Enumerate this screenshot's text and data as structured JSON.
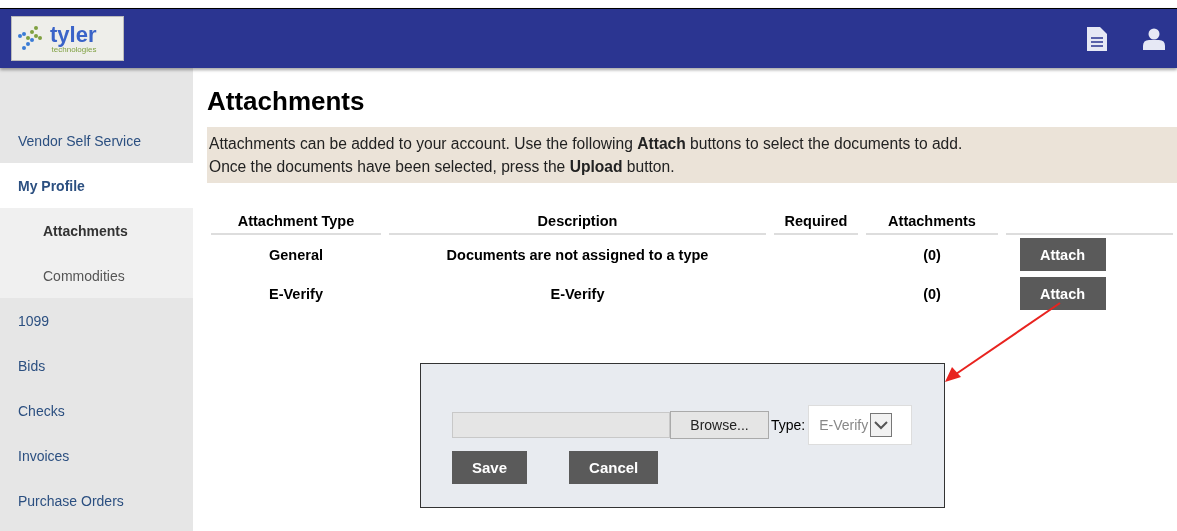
{
  "header": {
    "logo_word": "tyler",
    "logo_sub": "technologies"
  },
  "sidebar": {
    "items": [
      {
        "label": "Vendor Self Service",
        "kind": "section"
      },
      {
        "label": "My Profile",
        "kind": "item",
        "selected": true,
        "children": [
          {
            "label": "Attachments",
            "selected": true
          },
          {
            "label": "Commodities",
            "selected": false
          }
        ]
      },
      {
        "label": "1099",
        "kind": "item",
        "selected": false
      },
      {
        "label": "Bids",
        "kind": "item",
        "selected": false
      },
      {
        "label": "Checks",
        "kind": "item",
        "selected": false
      },
      {
        "label": "Invoices",
        "kind": "item",
        "selected": false
      },
      {
        "label": "Purchase Orders",
        "kind": "item",
        "selected": false
      }
    ]
  },
  "page": {
    "title": "Attachments",
    "instructions": [
      "Attachments can be added to your account. Use the following **Attach** buttons to select the documents to add.",
      "Once the documents have been selected, press the **Upload** button."
    ]
  },
  "table": {
    "columns": [
      "Attachment Type",
      "Description",
      "Required",
      "Attachments"
    ],
    "rows": [
      {
        "type": "General",
        "description": "Documents are not assigned to a type",
        "attachments": "(0)",
        "action": "Attach"
      },
      {
        "type": "E-Verify",
        "description": "E-Verify",
        "attachments": "(0)",
        "action": "Attach"
      }
    ]
  },
  "dialog": {
    "browse": "Browse...",
    "type_label": "Type:",
    "type_value": "E-Verify",
    "buttons": [
      "Save",
      "Cancel"
    ]
  }
}
